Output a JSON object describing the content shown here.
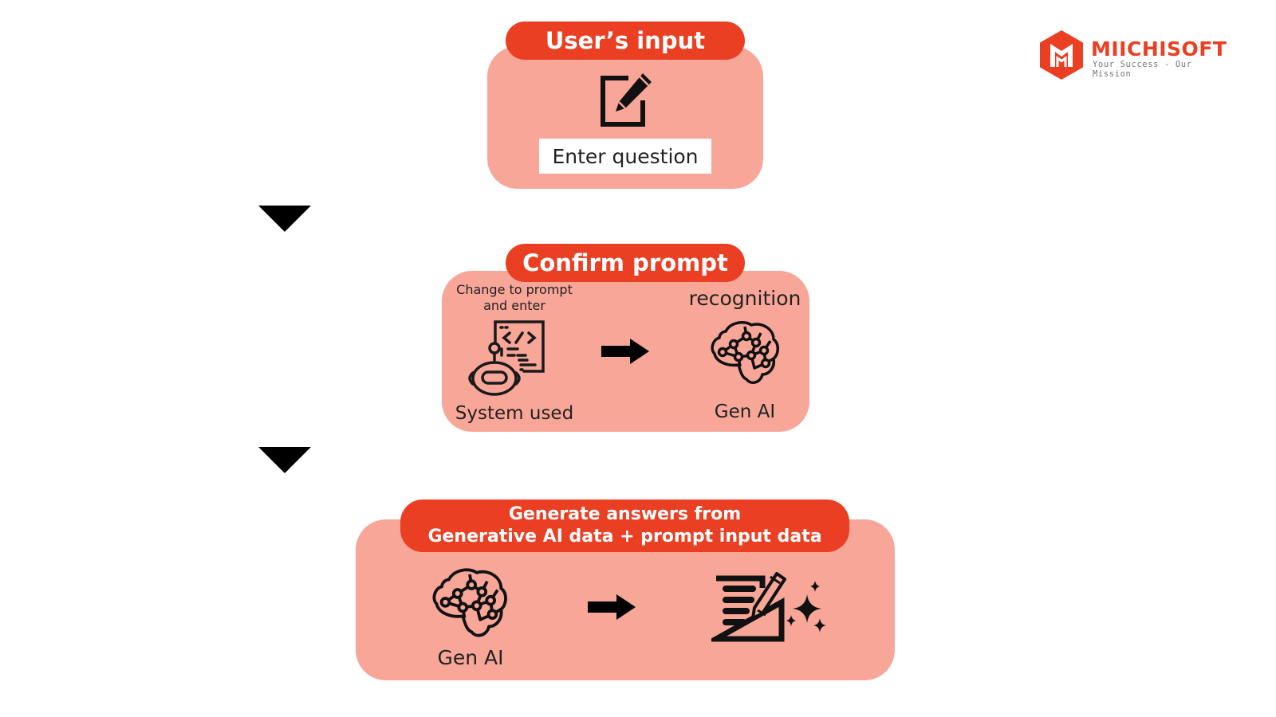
{
  "brand": {
    "name": "MIICHISOFT",
    "tagline": "Your Success - Our Mission",
    "logo_icon": "hexagon-m-logo",
    "color": "#ea3f23"
  },
  "colors": {
    "pill": "#ea3f23",
    "panel": "#f7a698",
    "icon": "#111111"
  },
  "steps": [
    {
      "title": "User’s input",
      "icon": "edit-icon",
      "input_label": "Enter question"
    },
    {
      "title": "Confirm prompt",
      "left_caption_top": [
        "Change to prompt",
        "and enter"
      ],
      "left_icon": "robot-code-icon",
      "left_label": "System used",
      "arrow_icon": "arrow-right-icon",
      "right_caption_top": "recognition",
      "right_icon": "brain-network-icon",
      "right_label": "Gen AI"
    },
    {
      "title_lines": [
        "Generate answers from",
        "Generative AI data + prompt input data"
      ],
      "left_icon": "brain-network-icon",
      "left_label": "Gen AI",
      "arrow_icon": "arrow-right-icon",
      "right_icon": "document-pencil-sparkle-icon"
    }
  ],
  "connectors": [
    "triangle-down-icon",
    "triangle-down-icon"
  ]
}
